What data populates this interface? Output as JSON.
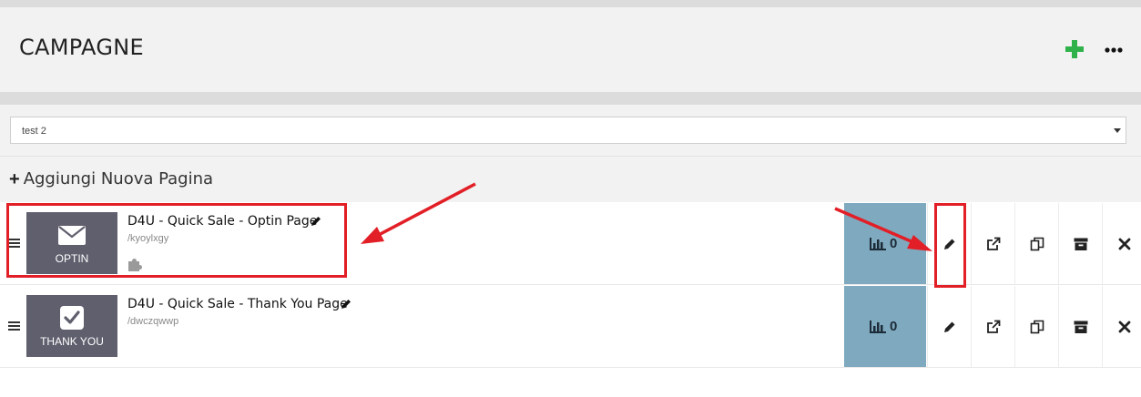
{
  "header": {
    "title": "CAMPAGNE",
    "add_icon": "plus-icon",
    "more_icon": "ellipsis-icon",
    "accent_color": "#2fb24a"
  },
  "campaign_select": {
    "value": "test 2"
  },
  "add_page": {
    "label": "Aggiungi Nuova Pagina"
  },
  "pages": [
    {
      "title": "D4U - Quick Sale - Optin Page",
      "slug": "/kyoylxgy",
      "thumb_label": "OPTIN",
      "thumb_icon": "envelope-icon",
      "stats": "0",
      "has_puzzle": true
    },
    {
      "title": "D4U - Quick Sale - Thank You Page",
      "slug": "/dwczqwwp",
      "thumb_label": "THANK YOU",
      "thumb_icon": "checkbox-icon",
      "stats": "0",
      "has_puzzle": false
    }
  ],
  "row_actions": [
    "edit-icon",
    "external-link-icon",
    "duplicate-icon",
    "archive-icon",
    "delete-icon"
  ],
  "annotations": {
    "highlight_color": "#e21f26"
  }
}
